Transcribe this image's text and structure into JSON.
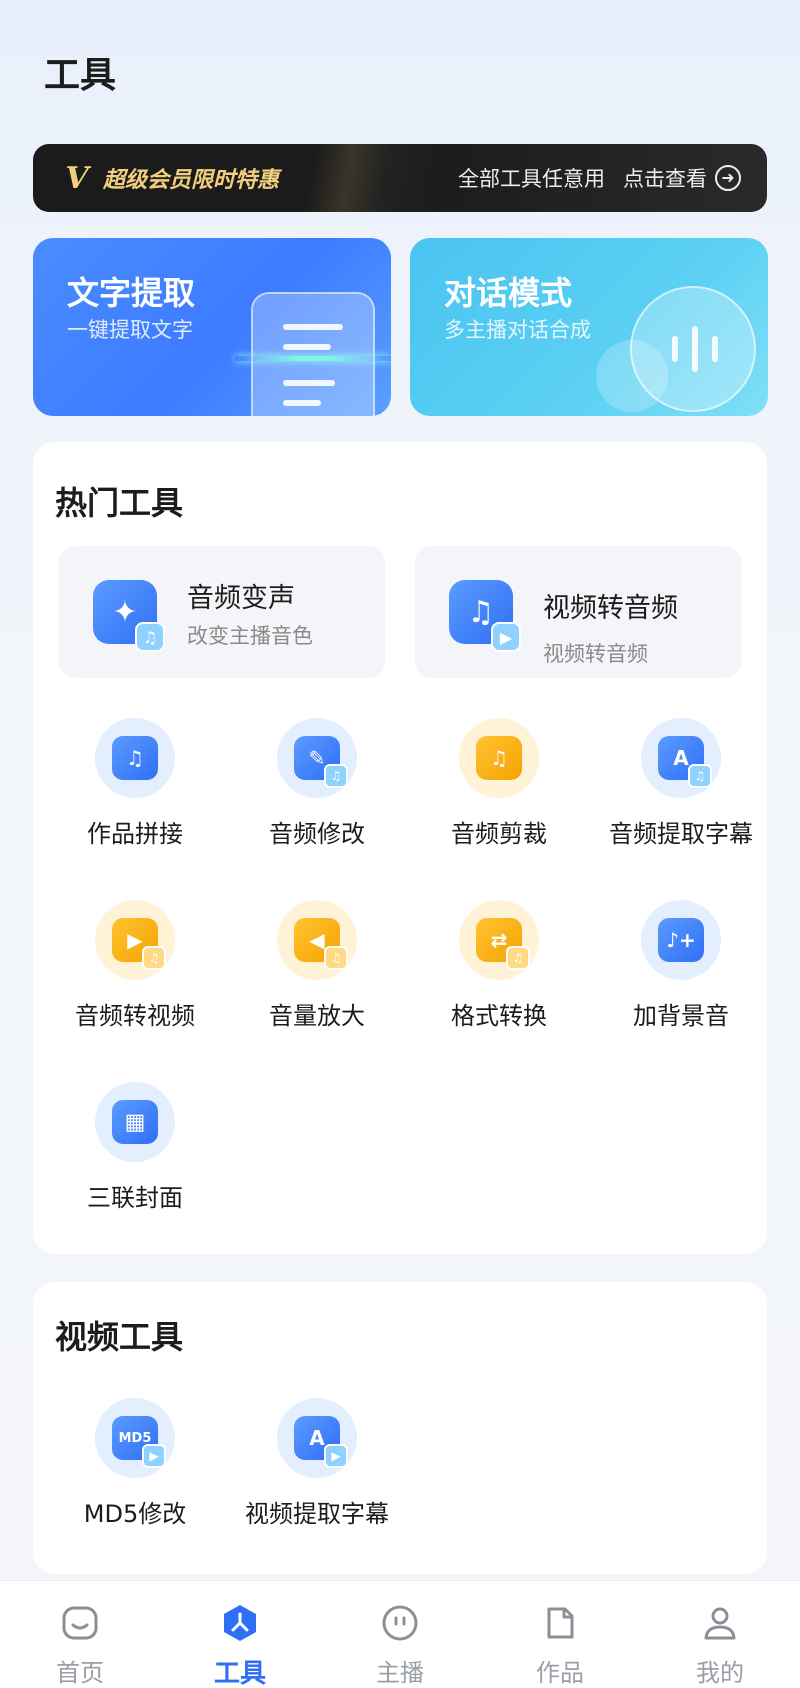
{
  "header": {
    "title": "工具"
  },
  "vip_banner": {
    "title": "超级会员限时特惠",
    "desc": "全部工具任意用",
    "action": "点击查看"
  },
  "feature_cards": [
    {
      "title": "文字提取",
      "subtitle": "一键提取文字"
    },
    {
      "title": "对话模式",
      "subtitle": "多主播对话合成"
    }
  ],
  "hot_tools": {
    "title": "热门工具",
    "featured": [
      {
        "title": "音频变声",
        "subtitle": "改变主播音色",
        "icon": "magic-wand-icon"
      },
      {
        "title": "视频转音频",
        "subtitle": "视频转音频",
        "icon": "music-note-icon"
      }
    ],
    "items": [
      {
        "label": "作品拼接",
        "icon": "stack-music-icon"
      },
      {
        "label": "音频修改",
        "icon": "edit-audio-icon"
      },
      {
        "label": "音频剪裁",
        "icon": "film-cut-icon"
      },
      {
        "label": "音频提取字幕",
        "icon": "subtitle-extract-icon"
      },
      {
        "label": "音频转视频",
        "icon": "play-video-icon"
      },
      {
        "label": "音量放大",
        "icon": "volume-up-icon"
      },
      {
        "label": "格式转换",
        "icon": "format-convert-icon"
      },
      {
        "label": "加背景音",
        "icon": "add-music-icon"
      },
      {
        "label": "三联封面",
        "icon": "grid-cover-icon"
      }
    ]
  },
  "video_tools": {
    "title": "视频工具",
    "items": [
      {
        "label": "MD5修改",
        "icon": "md5-icon"
      },
      {
        "label": "视频提取字幕",
        "icon": "video-subtitle-icon"
      }
    ]
  },
  "bottom_nav": {
    "items": [
      {
        "label": "首页",
        "icon": "home-icon"
      },
      {
        "label": "工具",
        "icon": "tools-icon"
      },
      {
        "label": "主播",
        "icon": "anchor-icon"
      },
      {
        "label": "作品",
        "icon": "document-icon"
      },
      {
        "label": "我的",
        "icon": "profile-icon"
      }
    ],
    "active": "工具"
  },
  "colors": {
    "accent": "#2f6ff5",
    "vip_gold": "#f2cf7e",
    "tool_yellow": "#f5a300"
  }
}
